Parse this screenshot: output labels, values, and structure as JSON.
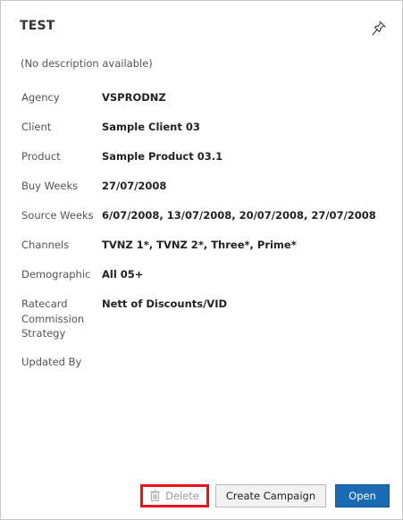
{
  "header": {
    "title": "TEST"
  },
  "description": "(No description available)",
  "fields": [
    {
      "label": "Agency",
      "value": "VSPRODNZ"
    },
    {
      "label": "Client",
      "value": "Sample Client 03"
    },
    {
      "label": "Product",
      "value": "Sample Product 03.1"
    },
    {
      "label": "Buy Weeks",
      "value": "27/07/2008"
    },
    {
      "label": "Source Weeks",
      "value": "6/07/2008, 13/07/2008, 20/07/2008, 27/07/2008"
    },
    {
      "label": "Channels",
      "value": "TVNZ 1*, TVNZ 2*, Three*, Prime*"
    },
    {
      "label": "Demographic",
      "value": "All 05+"
    },
    {
      "label": "Ratecard\nCommission\nStrategy",
      "value": "Nett of Discounts/VID"
    },
    {
      "label": "Updated By",
      "value": ""
    }
  ],
  "footer": {
    "delete_label": "Delete",
    "create_label": "Create Campaign",
    "open_label": "Open"
  },
  "icons": {
    "pin": "pin-icon",
    "delete": "trash-icon"
  },
  "colors": {
    "primary": "#1a6ab4",
    "highlight": "#e8141d"
  }
}
